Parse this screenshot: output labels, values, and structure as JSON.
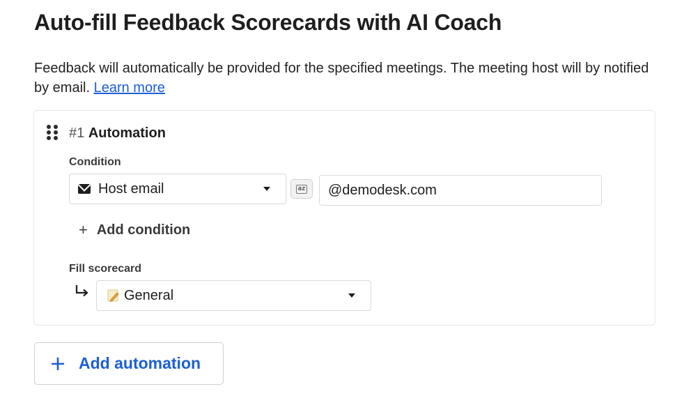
{
  "header": {
    "title": "Auto-fill Feedback Scorecards with AI Coach",
    "description": "Feedback will automatically be provided for the specified meetings. The meeting host will by notified by email.",
    "learn_more": "Learn more"
  },
  "automation": {
    "number": "#1",
    "name": "Automation",
    "condition_label": "Condition",
    "condition_field": "Host email",
    "condition_value": "@demodesk.com",
    "add_condition_label": "Add condition",
    "fill_scorecard_label": "Fill scorecard",
    "scorecard_value": "General"
  },
  "footer": {
    "add_automation_label": "Add automation"
  },
  "icons": {
    "drag": "drag-handle-icon",
    "mail": "mail-icon",
    "match_mode": "regex-toggle-icon",
    "plus": "plus-icon",
    "return_arrow": "return-arrow-icon",
    "scorecard": "pencil-note-icon",
    "caret": "caret-down-icon"
  },
  "colors": {
    "accent": "#1a5fd6",
    "text": "#1e1e1e",
    "border": "#d9d9d9"
  }
}
